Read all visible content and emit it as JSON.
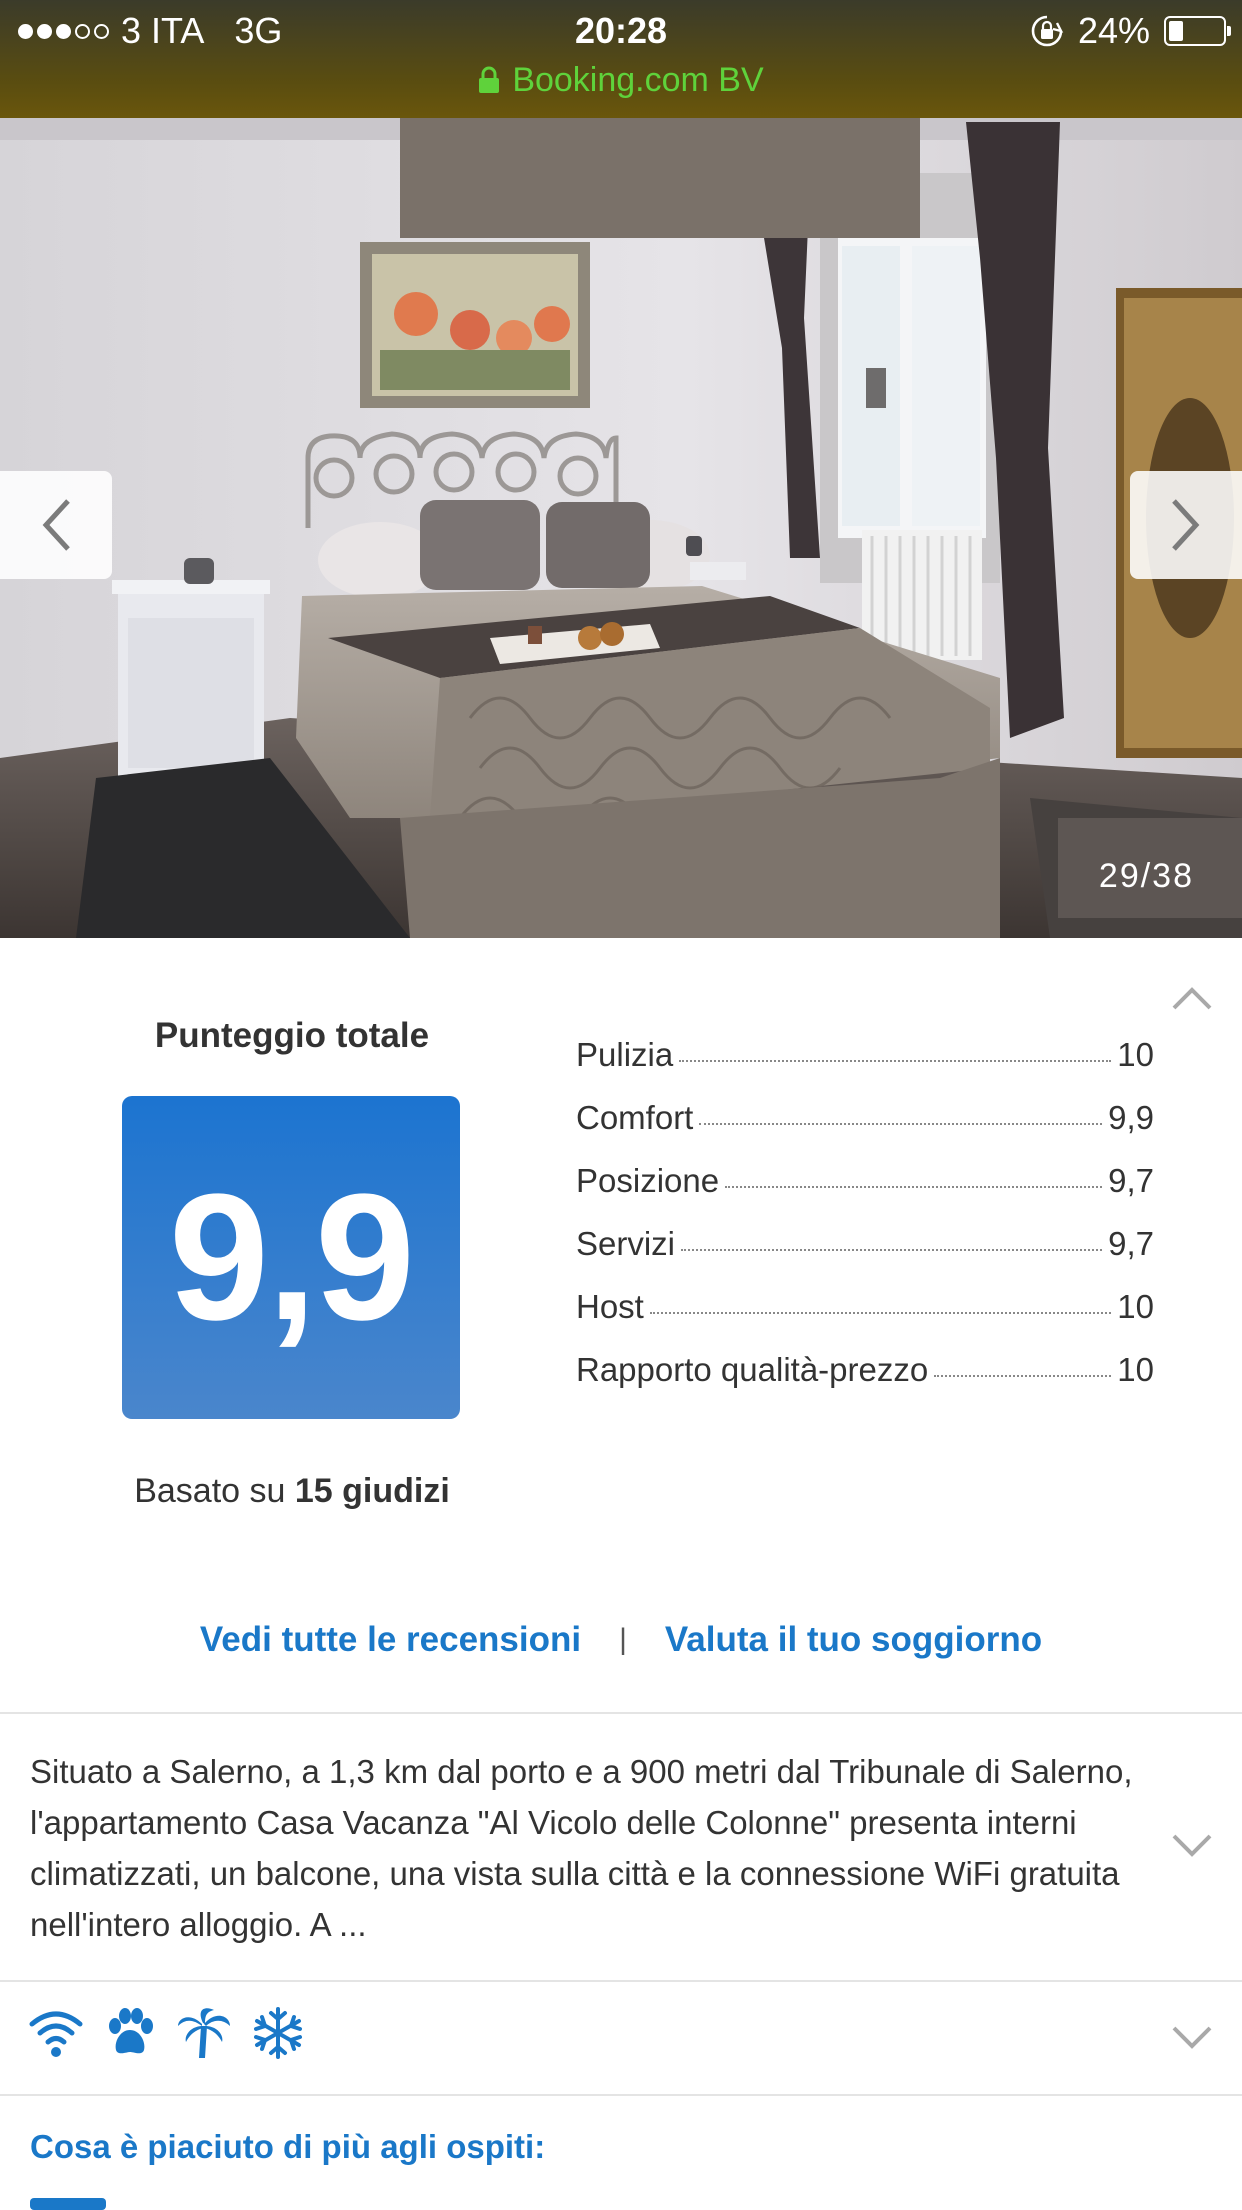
{
  "status_bar": {
    "carrier": "3 ITA",
    "network": "3G",
    "time": "20:28",
    "battery": "24%",
    "battery_level": 0.24,
    "url": "Booking.com BV"
  },
  "gallery": {
    "counter": "29/38"
  },
  "score": {
    "title": "Punteggio totale",
    "value": "9,9",
    "based_prefix": "Basato su ",
    "based_count": "15 giudizi",
    "categories": [
      {
        "label": "Pulizia",
        "value": "10"
      },
      {
        "label": "Comfort",
        "value": "9,9"
      },
      {
        "label": "Posizione",
        "value": "9,7"
      },
      {
        "label": "Servizi",
        "value": "9,7"
      },
      {
        "label": "Host",
        "value": "10"
      },
      {
        "label": "Rapporto qualità-prezzo",
        "value": "10"
      }
    ]
  },
  "links": {
    "all_reviews": "Vedi tutte le recensioni",
    "separator": "|",
    "rate_stay": "Valuta il tuo soggiorno"
  },
  "description": {
    "text": "Situato a Salerno, a 1,3 km dal porto e a 900 metri dal Tribunale di Salerno, l'appartamento Casa Vacanza \"Al Vicolo delle Colonne\" presenta interni climatizzati, un balcone, una vista sulla città e la connessione WiFi gratuita nell'intero alloggio. A ..."
  },
  "amenities": {
    "icons": [
      "wifi-icon",
      "paw-icon",
      "palm-tree-icon",
      "snowflake-icon"
    ]
  },
  "liked": {
    "title": "Cosa è piaciuto di più agli ospiti:"
  },
  "colors": {
    "accent": "#1a78c8",
    "score_box": "#2a7bd0",
    "url_green": "#5fd23b"
  }
}
